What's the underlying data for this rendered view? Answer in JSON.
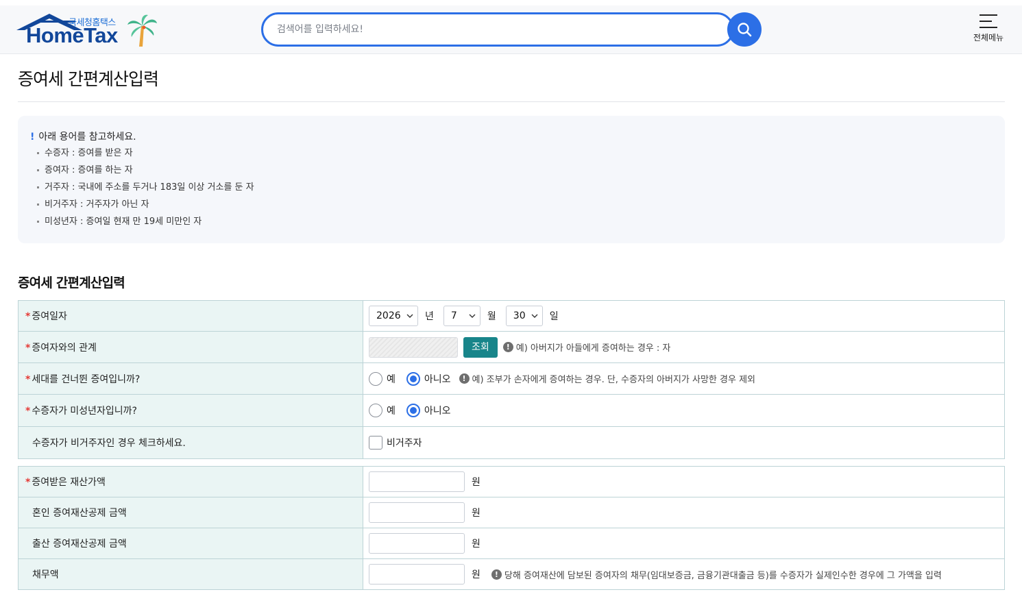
{
  "header": {
    "logo_sub": "국세청홈택스",
    "logo_main": "HomeTax",
    "search_placeholder": "검색어를 입력하세요!",
    "menu_label": "전체메뉴"
  },
  "page_title": "증여세 간편계산입력",
  "info": {
    "heading": "아래 용어를 참고하세요.",
    "items": [
      "수증자 : 증여를 받은 자",
      "증여자 : 증여를 하는 자",
      "거주자 : 국내에 주소를 두거나 183일 이상 거소를 둔 자",
      "비거주자 : 거주자가 아닌 자",
      "미성년자 : 증여일 현재 만 19세 미만인 자"
    ]
  },
  "section_title": "증여세 간편계산입력",
  "form1": {
    "date": {
      "label": "증여일자",
      "year": "2026",
      "year_unit": "년",
      "month": "7",
      "month_unit": "월",
      "day": "30",
      "day_unit": "일"
    },
    "relation": {
      "label": "증여자와의 관계",
      "button": "조회",
      "hint": "예) 아버지가 아들에게 증여하는 경우 : 자"
    },
    "skip_generation": {
      "label": "세대를 건너뛴 증여입니까?",
      "yes": "예",
      "no": "아니오",
      "selected": "no",
      "hint": "예) 조부가 손자에게 증여하는 경우. 단, 수증자의 아버지가 사망한 경우 제외"
    },
    "minor": {
      "label": "수증자가 미성년자입니까?",
      "yes": "예",
      "no": "아니오",
      "selected": "no"
    },
    "nonresident": {
      "label": "수증자가 비거주자인 경우 체크하세요.",
      "checkbox_label": "비거주자",
      "checked": false
    }
  },
  "form2": {
    "property": {
      "label": "증여받은 재산가액",
      "value": "",
      "unit": "원"
    },
    "marriage": {
      "label": "혼인 증여재산공제 금액",
      "value": "",
      "unit": "원"
    },
    "birth": {
      "label": "출산 증여재산공제 금액",
      "value": "",
      "unit": "원"
    },
    "debt": {
      "label": "채무액",
      "value": "",
      "unit": "원",
      "hint": "당해 증여재산에 담보된 증여자의 채무(임대보증금, 금융기관대출금 등)를 수증자가 실제인수한 경우에 그 가액을 입력"
    }
  },
  "colors": {
    "accent": "#2c6fe6",
    "teal_button": "#18858a",
    "label_bg": "#eaf5f4",
    "required": "#e53935"
  }
}
